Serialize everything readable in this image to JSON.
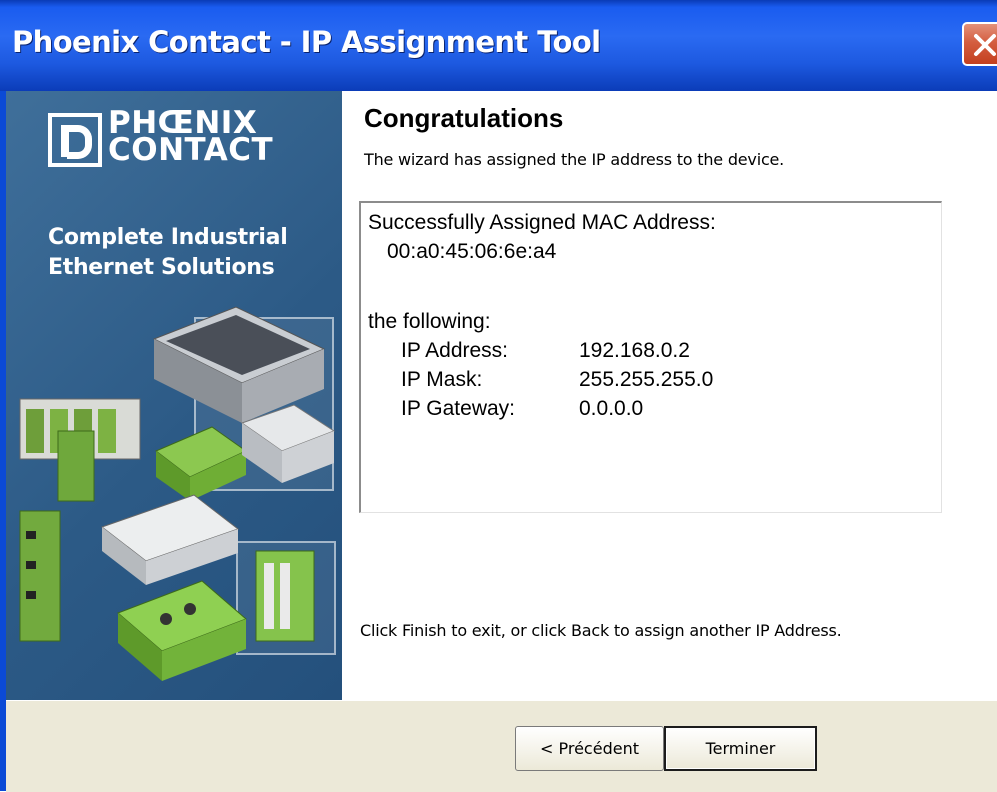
{
  "window": {
    "title": "Phoenix Contact - IP Assignment Tool"
  },
  "banner": {
    "logo_line1": "PHŒNIX",
    "logo_line2": "CONTACT",
    "tagline_line1": "Complete Industrial",
    "tagline_line2": "Ethernet Solutions"
  },
  "content": {
    "heading": "Congratulations",
    "subtext": "The wizard has assigned the IP address to the device.",
    "result": {
      "mac_label": "Successfully Assigned MAC Address:",
      "mac_value": "00:a0:45:06:6e:a4",
      "following_label": "the following:",
      "ip_address_label": "IP Address:",
      "ip_address_value": "192.168.0.2",
      "ip_mask_label": "IP Mask:",
      "ip_mask_value": "255.255.255.0",
      "ip_gateway_label": "IP Gateway:",
      "ip_gateway_value": "0.0.0.0"
    },
    "finish_text": "Click Finish to exit, or click Back to assign another IP Address."
  },
  "buttons": {
    "back_label": "< Précédent",
    "finish_label": "Terminer"
  },
  "colors": {
    "titlebar": "#2a6af2",
    "banner": "#2c5a86",
    "close_button": "#d45e40",
    "dialog_bar": "#ece9d8"
  }
}
